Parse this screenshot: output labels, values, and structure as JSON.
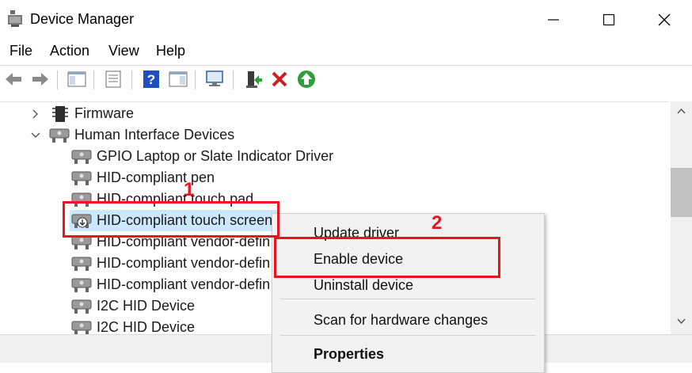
{
  "window": {
    "title": "Device Manager"
  },
  "menu": {
    "items": [
      "File",
      "Action",
      "View",
      "Help"
    ]
  },
  "toolbar": {
    "icons": [
      "back-arrow-icon",
      "forward-arrow-icon",
      "show-hide-tree-icon",
      "properties-icon",
      "help-icon",
      "view-icon",
      "scan-hardware-icon",
      "update-driver-icon",
      "uninstall-icon",
      "enable-device-icon"
    ],
    "accent_green": "#2e9d3a",
    "accent_red": "#d21e1e",
    "accent_blue": "#1f4fbf"
  },
  "tree": {
    "firmware": "Firmware",
    "hid": "Human Interface Devices",
    "items": [
      "GPIO Laptop or Slate Indicator Driver",
      "HID-compliant pen",
      "HID-compliant touch pad",
      "HID-compliant touch screen",
      "HID-compliant vendor-defin",
      "HID-compliant vendor-defin",
      "HID-compliant vendor-defin",
      "I2C HID Device",
      "I2C HID Device"
    ],
    "selected": "HID-compliant touch screen",
    "selected_color": "#cce8ff"
  },
  "context_menu": {
    "update": "Update driver",
    "enable": "Enable device",
    "uninstall": "Uninstall device",
    "scan": "Scan for hardware changes",
    "properties": "Properties"
  },
  "annotations": {
    "step1": "1",
    "step2": "2",
    "color": "#e8141e"
  }
}
